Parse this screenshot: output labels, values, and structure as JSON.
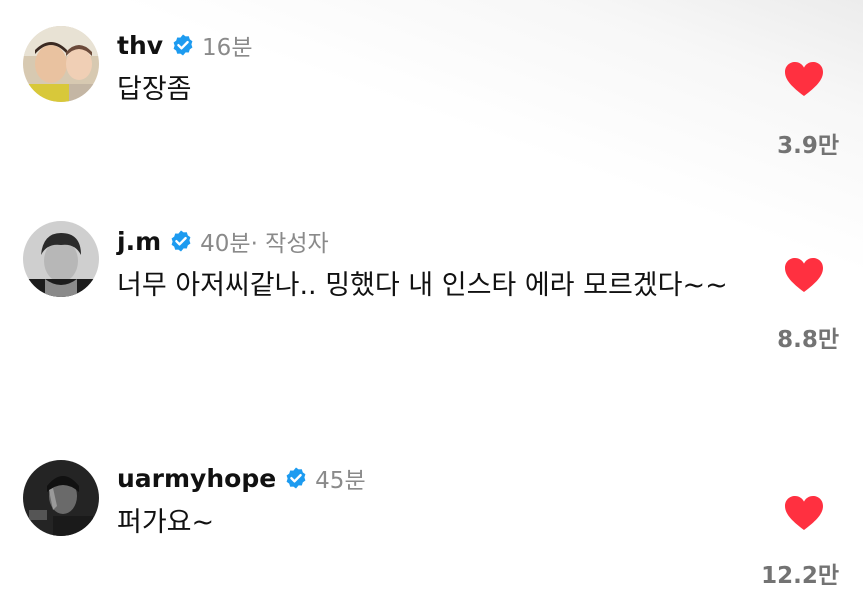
{
  "colors": {
    "verified_blue": "#1d9bf0",
    "heart_red": "#ff3040",
    "meta_gray": "#8a8a8a",
    "count_gray": "#737373"
  },
  "comments": [
    {
      "username": "thv",
      "verified": true,
      "time": "16분",
      "author_tag": "",
      "text": "답장좀",
      "like_icon": "heart-filled-icon",
      "liked": true,
      "likes": "3.9만"
    },
    {
      "username": "j.m",
      "verified": true,
      "time": "40분",
      "author_tag": " · 작성자",
      "text": "너무 아저씨같나.. 밍했다 내 인스타 에라 모르겠다~~",
      "like_icon": "heart-filled-icon",
      "liked": true,
      "likes": "8.8만"
    },
    {
      "username": "uarmyhope",
      "verified": true,
      "time": "45분",
      "author_tag": "",
      "text": "퍼가요~",
      "like_icon": "heart-filled-icon",
      "liked": true,
      "likes": "12.2만"
    }
  ]
}
